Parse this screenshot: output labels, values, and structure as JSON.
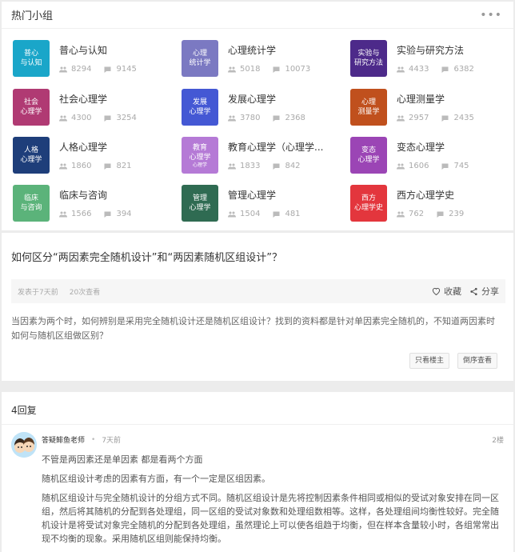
{
  "groups": {
    "title": "热门小组",
    "more_icon": "more-dots-icon",
    "items": [
      {
        "tile_line1": "普心",
        "tile_line2": "与认知",
        "tile_sub": "",
        "color": "#1aa6c9",
        "name": "普心与认知",
        "members": "8294",
        "posts": "9145"
      },
      {
        "tile_line1": "心理",
        "tile_line2": "统计学",
        "tile_sub": "",
        "color": "#7b79c2",
        "name": "心理统计学",
        "members": "5018",
        "posts": "10073"
      },
      {
        "tile_line1": "实验与",
        "tile_line2": "研究方法",
        "tile_sub": "",
        "color": "#4d2a8a",
        "name": "实验与研究方法",
        "members": "4433",
        "posts": "6382"
      },
      {
        "tile_line1": "社会",
        "tile_line2": "心理学",
        "tile_sub": "",
        "color": "#b03a73",
        "name": "社会心理学",
        "members": "4300",
        "posts": "3254"
      },
      {
        "tile_line1": "发展",
        "tile_line2": "心理学",
        "tile_sub": "",
        "color": "#4458d4",
        "name": "发展心理学",
        "members": "3780",
        "posts": "2368"
      },
      {
        "tile_line1": "心理",
        "tile_line2": "测量学",
        "tile_sub": "",
        "color": "#c0501d",
        "name": "心理测量学",
        "members": "2957",
        "posts": "2435"
      },
      {
        "tile_line1": "人格",
        "tile_line2": "心理学",
        "tile_sub": "",
        "color": "#1e3e7a",
        "name": "人格心理学",
        "members": "1860",
        "posts": "821"
      },
      {
        "tile_line1": "教育",
        "tile_line2": "心理学",
        "tile_sub": "心理学",
        "color": "#b57ad6",
        "name": "教育心理学（心理学...",
        "members": "1833",
        "posts": "842"
      },
      {
        "tile_line1": "变态",
        "tile_line2": "心理学",
        "tile_sub": "",
        "color": "#9b45b5",
        "name": "变态心理学",
        "members": "1606",
        "posts": "745"
      },
      {
        "tile_line1": "临床",
        "tile_line2": "与咨询",
        "tile_sub": "",
        "color": "#5bb37a",
        "name": "临床与咨询",
        "members": "1566",
        "posts": "394"
      },
      {
        "tile_line1": "管理",
        "tile_line2": "心理学",
        "tile_sub": "",
        "color": "#2f6b52",
        "name": "管理心理学",
        "members": "1504",
        "posts": "481"
      },
      {
        "tile_line1": "西方",
        "tile_line2": "心理学史",
        "tile_sub": "",
        "color": "#e3363d",
        "name": "西方心理学史",
        "members": "762",
        "posts": "239"
      }
    ]
  },
  "question": {
    "title": "如何区分“两因素完全随机设计”和“两因素随机区组设计”？",
    "posted": "发表于7天前",
    "views": "20次查看",
    "favorite_label": "收藏",
    "share_label": "分享",
    "body": "当因素为两个时，如何辨别是采用完全随机设计还是随机区组设计？找到的资料都是针对单因素完全随机的，不知道两因素时如何与随机区组做区别？",
    "only_author_label": "只看楼主",
    "reverse_order_label": "倒序查看"
  },
  "answers": {
    "count_label": "4回复",
    "first": {
      "author": "答疑鲱鱼老师",
      "dot": "•",
      "time": "7天前",
      "floor": "2楼",
      "p1": "不管是两因素还是单因素 都是看两个方面",
      "p2": "随机区组设计考虑的因素有方面，有一个一定是区组因素。",
      "p3": "随机区组设计与完全随机设计的分组方式不同。随机区组设计是先将控制因素条件相同或相似的受试对象安排在同一区组，然后将其随机的分配到各处理组，同一区组的受试对象数和处理组数相等。这样，各处理组间均衡性较好。完全随机设计是将受试对象完全随机的分配到各处理组，虽然理论上可以使各组趋于均衡，但在样本含量较小时，各组常常出现不均衡的现象。采用随机区组则能保持均衡。"
    }
  }
}
